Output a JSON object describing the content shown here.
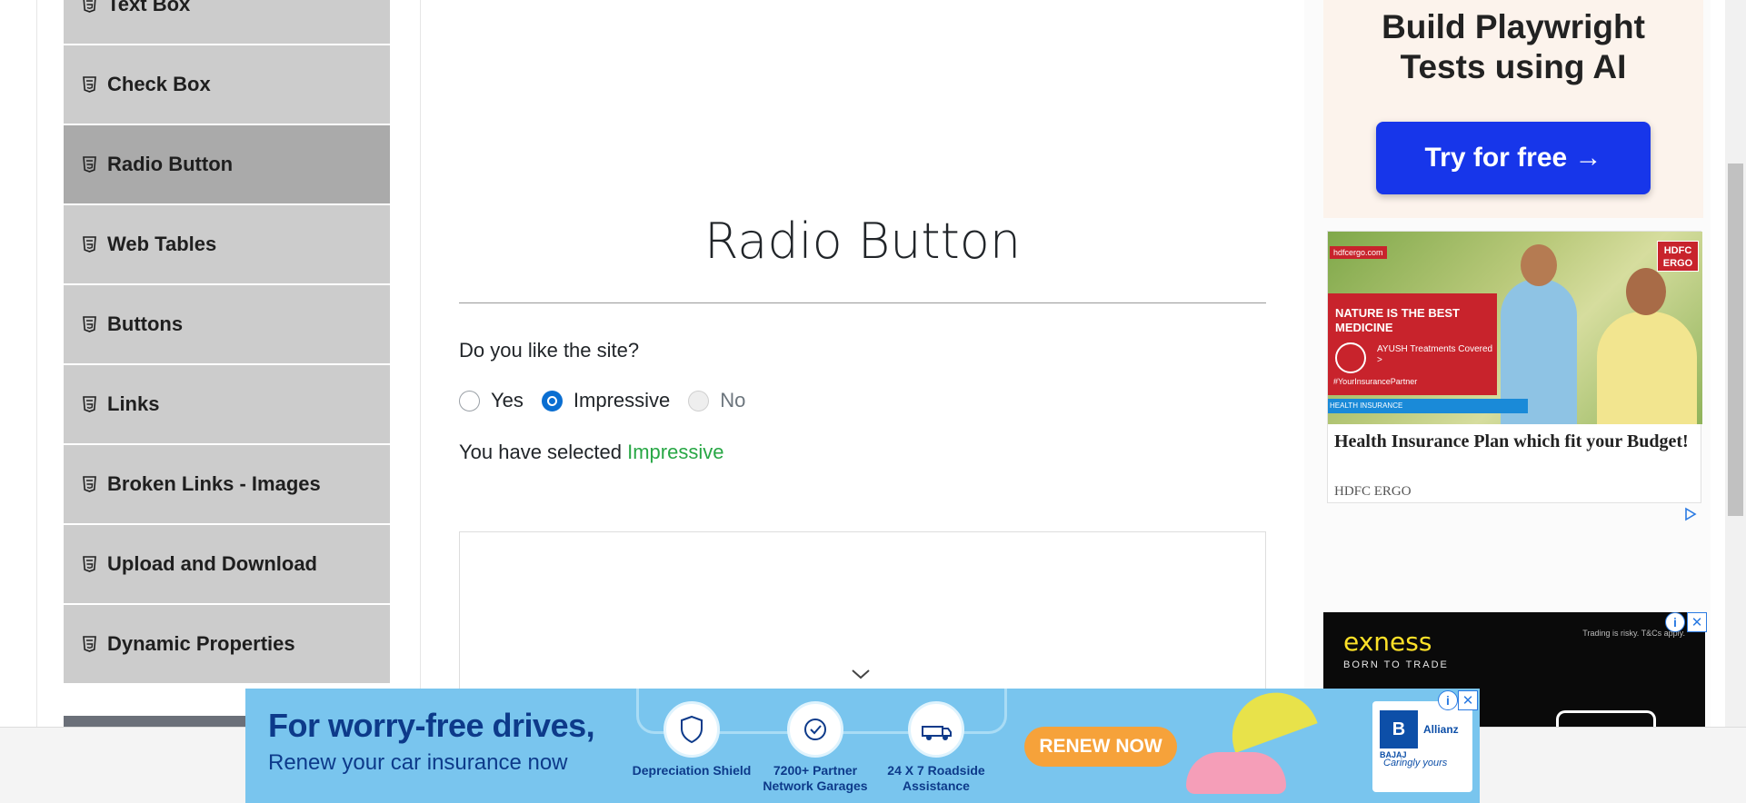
{
  "sidebar": {
    "items": [
      {
        "label": "Text Box"
      },
      {
        "label": "Check Box"
      },
      {
        "label": "Radio Button"
      },
      {
        "label": "Web Tables"
      },
      {
        "label": "Buttons"
      },
      {
        "label": "Links"
      },
      {
        "label": "Broken Links - Images"
      },
      {
        "label": "Upload and Download"
      },
      {
        "label": "Dynamic Properties"
      }
    ],
    "active_item": "Radio Button"
  },
  "main": {
    "title": "Radio Button",
    "question": "Do you like the site?",
    "options": [
      {
        "label": "Yes",
        "checked": false,
        "disabled": false
      },
      {
        "label": "Impressive",
        "checked": true,
        "disabled": false
      },
      {
        "label": "No",
        "checked": false,
        "disabled": true
      }
    ],
    "result_prefix": "You have selected ",
    "result_value": "Impressive"
  },
  "ads": {
    "playwright": {
      "headline_1": "Build Playwright",
      "headline_2": "Tests using AI",
      "cta": "Try for free →"
    },
    "hdfc": {
      "brand_tag": "hdfcergo.com",
      "logo_1": "HDFC",
      "logo_2": "ERGO",
      "banner_line": "NATURE IS THE BEST MEDICINE",
      "sub_line": "AYUSH Treatments Covered >",
      "hashtag": "#YourInsurancePartner",
      "strip": "HEALTH INSURANCE",
      "title": "Health Insurance Plan which fit your Budget!",
      "advertiser": "HDFC ERGO"
    },
    "exness": {
      "brand": "exness",
      "tagline": "BORN TO TRADE",
      "risk": "Trading is risky. T&Cs apply."
    },
    "car_insurance": {
      "headline": "For worry-free drives,",
      "subline": "Renew your car insurance now",
      "features": [
        {
          "label": "Depreciation Shield"
        },
        {
          "label": "7200+ Partner Network Garages"
        },
        {
          "label": "24 X 7 Roadside Assistance"
        }
      ],
      "cta": "RENEW NOW",
      "brand": "BAJAJ",
      "partner": "Allianz",
      "tagline": "Caringly yours"
    }
  },
  "colors": {
    "menu_bg": "#cccccc",
    "menu_active_bg": "#aaaaaa",
    "radio_checked": "#0a6ed1",
    "success_text": "#28a745",
    "cta_blue": "#1736ea"
  }
}
